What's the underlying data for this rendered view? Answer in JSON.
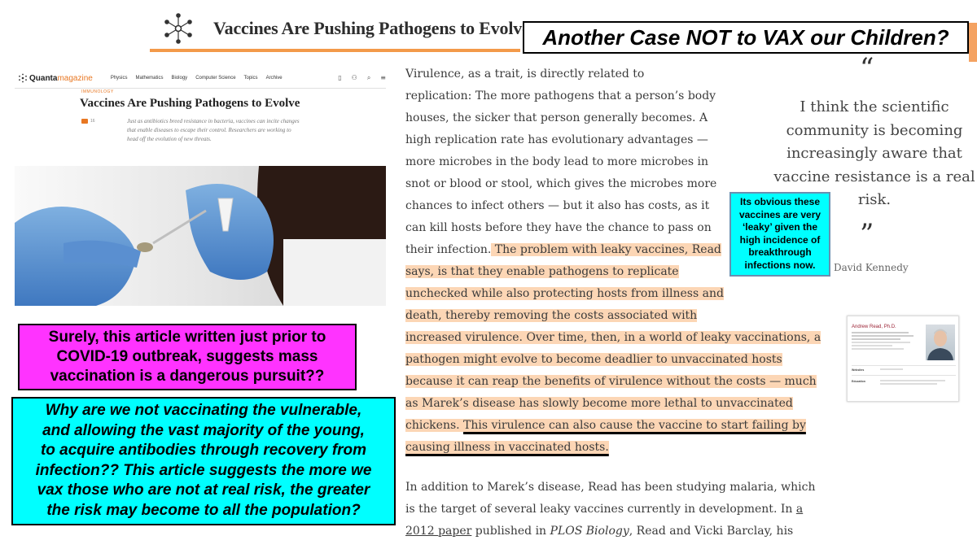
{
  "header": {
    "title": "Vaccines Are Pushing Pathogens to Evolve",
    "accent": "#f39a4a"
  },
  "headline": "Another Case NOT to VAX our Children?",
  "left_article": {
    "site": {
      "logo_word1": "Quanta",
      "logo_word2": "magazine",
      "nav": [
        "Physics",
        "Mathematics",
        "Biology",
        "Computer Science",
        "Topics",
        "Archive"
      ],
      "icons": [
        "bookmark-icon",
        "user-icon",
        "search-icon",
        "menu-icon"
      ]
    },
    "kicker": "IMMUNOLOGY",
    "title": "Vaccines Are Pushing Pathogens to Evolve",
    "comment_count": "16",
    "dek_lines": [
      "Just as antibiotics breed resistance in bacteria, vaccines can incite changes",
      "that enable diseases to escape their control. Researchers are working to",
      "head off the evolution of new threats."
    ]
  },
  "pink_box": {
    "lines": [
      "Surely, this article written just prior to",
      "COVID-19 outbreak, suggests mass",
      "vaccination is a dangerous pursuit??"
    ],
    "color": "#ff33ff"
  },
  "cyan_box": {
    "lines": [
      "Why are we not vaccinating the vulnerable,",
      "and allowing the vast majority of the young,",
      "to acquire antibodies through recovery from",
      "infection?? This article suggests the more we",
      "vax those who are not at real risk, the greater",
      "the risk may become to all the population?"
    ],
    "color": "#00ffff"
  },
  "body": {
    "p1_plain": [
      "Virulence, as a trait, is directly related to",
      "replication: The more pathogens that a person’s body",
      "houses, the sicker that person generally becomes. A",
      "high replication rate has evolutionary advantages —",
      "more microbes in the body lead to more microbes in",
      "snot or blood or stool, which gives the microbes more",
      "chances to infect others — but it also has costs, as it",
      "can kill hosts before they have the chance to pass on"
    ],
    "p1_l9_plain": "their infection.",
    "p1_l9_hl": " The problem with leaky vaccines, Read",
    "p1_hl": [
      "says, is that they enable pathogens to replicate",
      "unchecked while also protecting hosts from illness and",
      "death, thereby removing the costs associated with",
      "increased virulence. Over time, then, in a world of leaky vaccinations, a",
      "pathogen might evolve to become deadlier to unvaccinated hosts",
      "because it can reap the benefits of virulence without the costs — much",
      "as Marek’s disease has slowly become more lethal to unvaccinated"
    ],
    "p1_l17_a": "chickens. ",
    "p1_l17_b": "This virulence can also cause the vaccine to start failing by",
    "p1_l18": "causing illness in vaccinated hosts.",
    "p2_l1": "In addition to Marek’s disease, Read has been studying malaria, which",
    "p2_l2a": "is the target of several leaky vaccines currently in development. In ",
    "p2_l2b": "a",
    "p2_l3a": "2012 paper",
    "p2_l3b": " published in ",
    "p2_l3c": "PLOS Biology",
    "p2_l3d": ", Read and Vicki Barclay, his",
    "highlight_color": "#fcd6b5"
  },
  "blue_callout": {
    "lines": [
      "Its obvious these",
      "vaccines are very",
      "‘leaky’ given the",
      "high incidence of",
      "breakthrough",
      "infections now."
    ]
  },
  "quote": {
    "open_mark": "“",
    "lines": [
      "I think the scientific",
      "community is becoming",
      "increasingly aware that",
      "vaccine resistance is a real",
      "risk."
    ],
    "close_mark": "”",
    "attribution": "David Kennedy"
  },
  "profile": {
    "name": "Andrew Read, Ph.D.",
    "row1_label": "Websites",
    "row2_label": "Education"
  }
}
